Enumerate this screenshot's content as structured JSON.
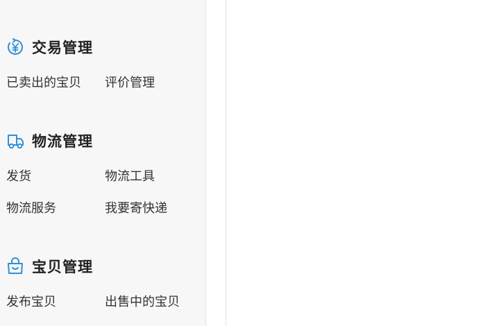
{
  "colors": {
    "icon_accent": "#2f8fd8",
    "title_text": "#222222",
    "link_text": "#333333",
    "sidebar_bg": "#f7f7f7"
  },
  "sections": [
    {
      "title": "交易管理",
      "icon": "yuan-circle-icon",
      "links": [
        "已卖出的宝贝",
        "评价管理"
      ]
    },
    {
      "title": "物流管理",
      "icon": "delivery-truck-icon",
      "links": [
        "发货",
        "物流工具",
        "物流服务",
        "我要寄快递"
      ]
    },
    {
      "title": "宝贝管理",
      "icon": "shopping-bag-icon",
      "links": [
        "发布宝贝",
        "出售中的宝贝"
      ]
    }
  ]
}
